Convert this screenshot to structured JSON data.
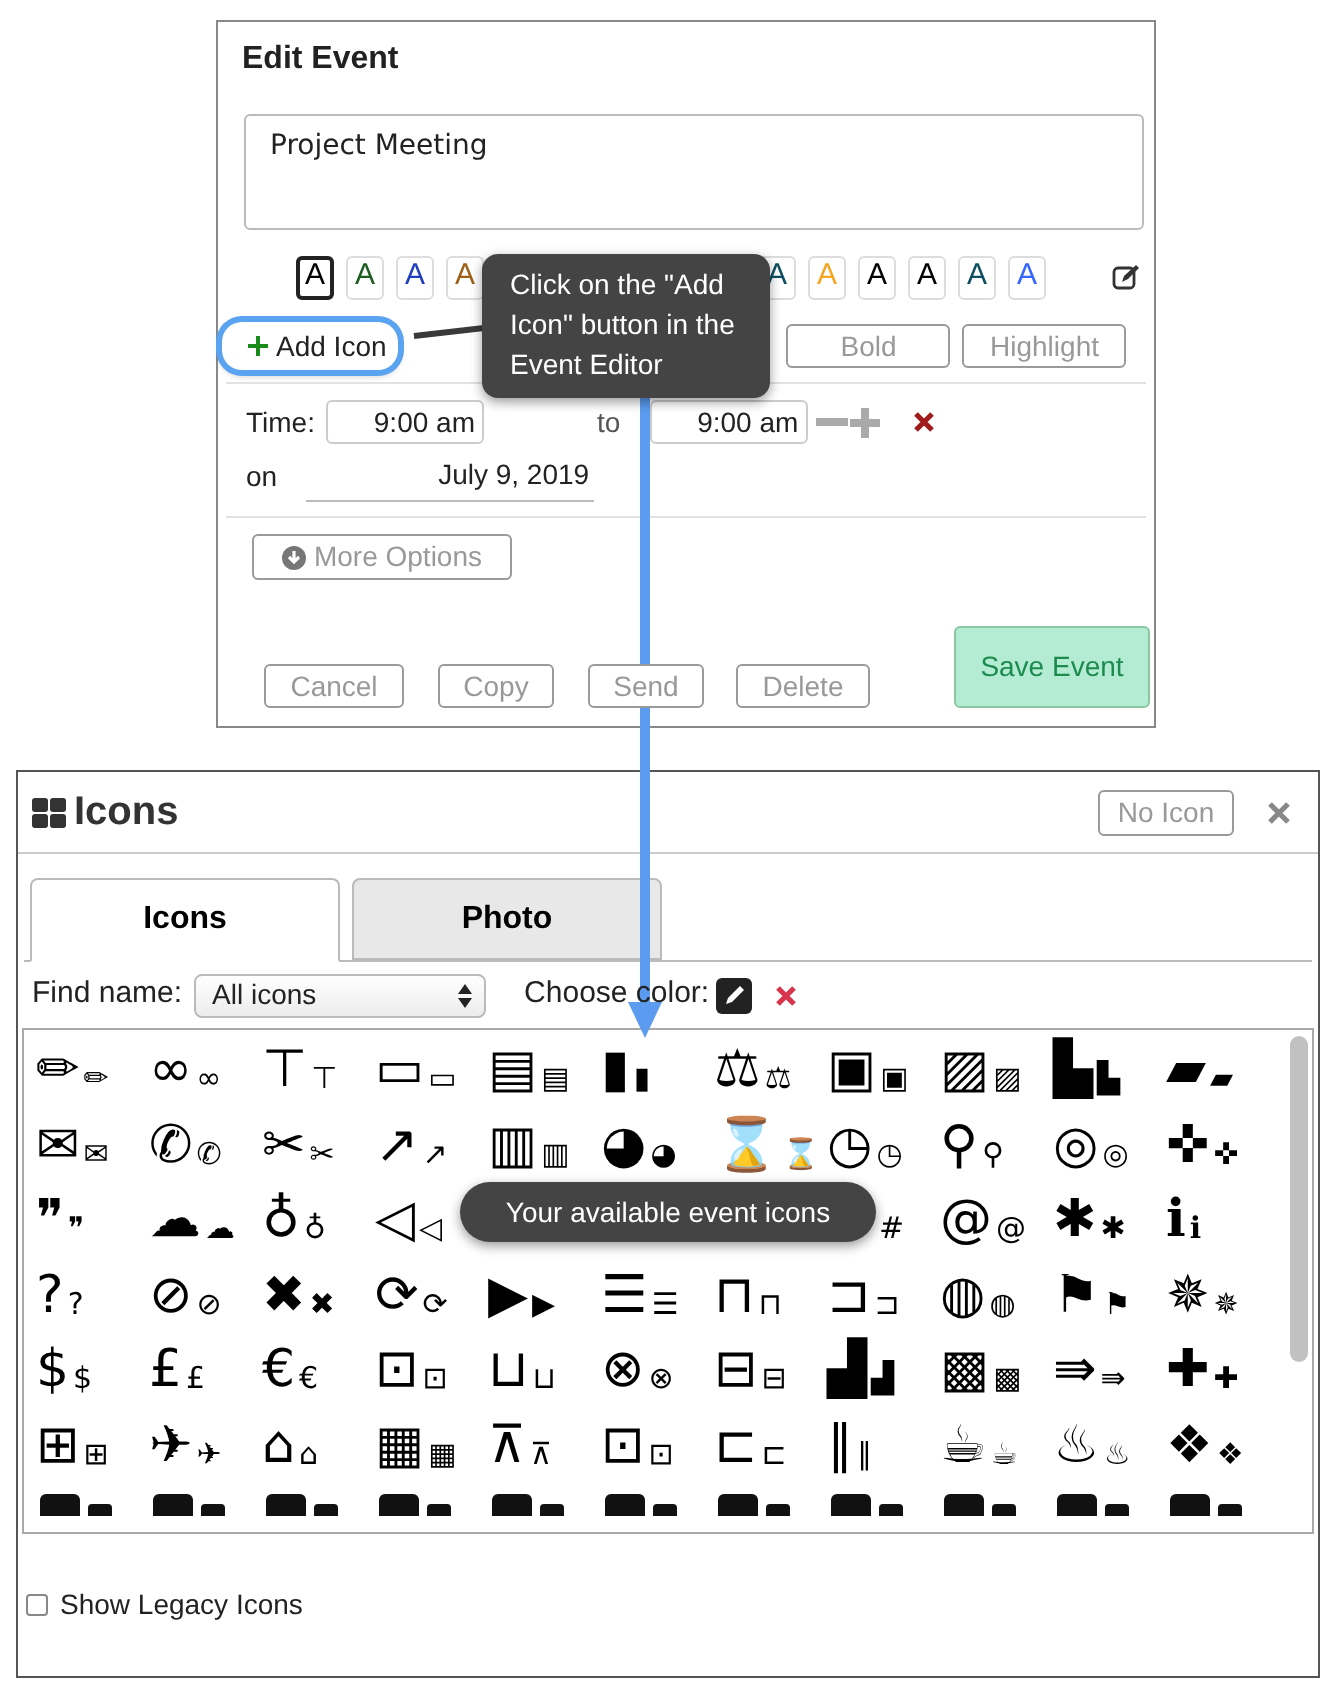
{
  "edit_event": {
    "title": "Edit Event",
    "event_text": "Project Meeting",
    "color_swatches": [
      {
        "label": "A",
        "color": "#000000",
        "selected": true
      },
      {
        "label": "A",
        "color": "#1b5e20",
        "selected": false
      },
      {
        "label": "A",
        "color": "#1f3fbf",
        "selected": false
      },
      {
        "label": "A",
        "color": "#a0601a",
        "selected": false
      },
      {
        "label": "A",
        "color": "#0e4f5f",
        "selected": false
      },
      {
        "label": "A",
        "color": "#f5a623",
        "selected": false
      },
      {
        "label": "A",
        "color": "#000000",
        "selected": false
      },
      {
        "label": "A",
        "color": "#000000",
        "selected": false
      },
      {
        "label": "A",
        "color": "#0e4f5f",
        "selected": false
      },
      {
        "label": "A",
        "color": "#3366ff",
        "selected": false
      }
    ],
    "add_icon": "Add Icon",
    "format_buttons": [
      "Bold",
      "Highlight"
    ],
    "time": {
      "label": "Time:",
      "start": "9:00 am",
      "to_label": "to",
      "end": "9:00 am"
    },
    "date": {
      "label": "on",
      "value": "July 9, 2019"
    },
    "more_options": "More Options",
    "actions": [
      "Cancel",
      "Copy",
      "Send",
      "Delete"
    ],
    "save": "Save Event"
  },
  "callouts": [
    "Click on the \"Add Icon\" button in the Event Editor",
    "Your available event icons"
  ],
  "icons_dialog": {
    "title": "Icons",
    "no_icon": "No Icon",
    "tabs": [
      {
        "label": "Icons",
        "selected": true
      },
      {
        "label": "Photo",
        "selected": false
      }
    ],
    "find_label": "Find name:",
    "find_value": "All icons",
    "color_label": "Choose color:",
    "icon_rows": [
      [
        [
          "✏",
          "✏"
        ],
        [
          "∞",
          "∞"
        ],
        [
          "⊤",
          "⊤"
        ],
        [
          "▭",
          "▭"
        ],
        [
          "▤",
          "▤"
        ],
        [
          "▮",
          "▮"
        ],
        [
          "⚖",
          "⚖"
        ],
        [
          "▣",
          "▣"
        ],
        [
          "▨",
          "▨"
        ],
        [
          "▙",
          "▙"
        ],
        [
          "▰",
          "▰"
        ]
      ],
      [
        [
          "✉",
          "✉"
        ],
        [
          "✆",
          "✆"
        ],
        [
          "✂",
          "✂"
        ],
        [
          "↗",
          "↗"
        ],
        [
          "▥",
          "▥"
        ],
        [
          "◕",
          "◕"
        ],
        [
          "⌛",
          "⌛"
        ],
        [
          "◷",
          "◷"
        ],
        [
          "⚲",
          "⚲"
        ],
        [
          "◎",
          "◎"
        ],
        [
          "✜",
          "✜"
        ]
      ],
      [
        [
          "❞",
          "❞"
        ],
        [
          "☁",
          "☁"
        ],
        [
          "♁",
          "♁"
        ],
        [
          "◁",
          "◁"
        ],
        null,
        null,
        null,
        [
          null,
          "#"
        ],
        [
          "@",
          "@"
        ],
        [
          "✱",
          "✱"
        ],
        [
          "ℹ",
          "ℹ"
        ]
      ],
      [
        [
          "?",
          "?"
        ],
        [
          "⊘",
          "⊘"
        ],
        [
          "✖",
          "✖"
        ],
        [
          "⟳",
          "⟳"
        ],
        [
          "▶",
          "▶"
        ],
        [
          "☰",
          "☰"
        ],
        [
          "⊓",
          "⊓"
        ],
        [
          "⊐",
          "⊐"
        ],
        [
          "◍",
          "◍"
        ],
        [
          "⚑",
          "⚑"
        ],
        [
          "✵",
          "✵"
        ]
      ],
      [
        [
          "$",
          "$"
        ],
        [
          "£",
          "£"
        ],
        [
          "€",
          "€"
        ],
        [
          "⊡",
          "⊡"
        ],
        [
          "⊔",
          "⊔"
        ],
        [
          "⊗",
          "⊗"
        ],
        [
          "⊟",
          "⊟"
        ],
        [
          "▟",
          "▟"
        ],
        [
          "▩",
          "▩"
        ],
        [
          "⇛",
          "⇛"
        ],
        [
          "✚",
          "✚"
        ]
      ],
      [
        [
          "⊞",
          "⊞"
        ],
        [
          "✈",
          "✈"
        ],
        [
          "⌂",
          "⌂"
        ],
        [
          "▦",
          "▦"
        ],
        [
          "⊼",
          "⊼"
        ],
        [
          "⊡",
          "⊡"
        ],
        [
          "⊏",
          "⊏"
        ],
        [
          "∥",
          "∥"
        ],
        [
          "☕",
          "☕"
        ],
        [
          "♨",
          "♨"
        ],
        [
          "❖",
          "❖"
        ]
      ]
    ],
    "legacy": {
      "label": "Show Legacy Icons",
      "checked": false
    }
  }
}
